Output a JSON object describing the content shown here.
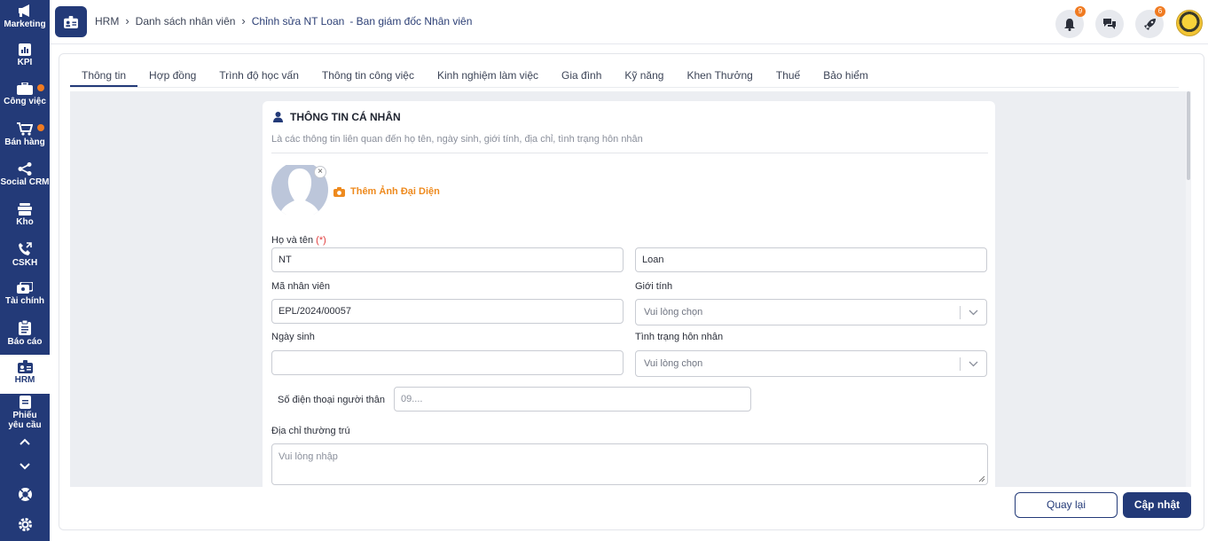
{
  "sidebar": {
    "items": [
      {
        "label": "Marketing",
        "icon": "megaphone-icon"
      },
      {
        "label": "KPI",
        "icon": "chart-icon"
      },
      {
        "label": "Công việc",
        "icon": "briefcase-icon",
        "dot": true
      },
      {
        "label": "Bán hàng",
        "icon": "cart-icon",
        "dot": true
      },
      {
        "label": "Social CRM",
        "icon": "share-icon"
      },
      {
        "label": "Kho",
        "icon": "warehouse-icon"
      },
      {
        "label": "CSKH",
        "icon": "phone-icon"
      },
      {
        "label": "Tài chính",
        "icon": "money-icon"
      },
      {
        "label": "Báo cáo",
        "icon": "clipboard-icon"
      },
      {
        "label": "HRM",
        "icon": "id-card-icon",
        "active": true
      },
      {
        "label": "Phiếu yêu cầu",
        "icon": "document-icon"
      }
    ]
  },
  "header": {
    "breadcrumb": {
      "root": "HRM",
      "list": "Danh sách nhân viên",
      "current": "Chỉnh sửa NT Loan",
      "dept": "- Ban giám đốc Nhân viên"
    },
    "notifications_count": "9",
    "rocket_count": "6"
  },
  "tabs": [
    "Thông tin",
    "Hợp đồng",
    "Trình độ học vấn",
    "Thông tin công việc",
    "Kinh nghiệm làm việc",
    "Gia đình",
    "Kỹ năng",
    "Khen Thưởng",
    "Thuế",
    "Bảo hiểm"
  ],
  "section": {
    "title": "THÔNG TIN CÁ NHÂN",
    "subtitle": "Là các thông tin liên quan đến họ tên, ngày sinh, giới tính, địa chỉ, tình trạng hôn nhân",
    "add_photo": "Thêm Ảnh Đại Diện"
  },
  "form": {
    "fullname_label": "Họ và tên",
    "required_mark": "(*)",
    "first_name": "NT",
    "last_name": "Loan",
    "employee_code_label": "Mã nhân viên",
    "employee_code": "EPL/2024/00057",
    "gender_label": "Giới tính",
    "gender_placeholder": "Vui lòng chọn",
    "dob_label": "Ngày sinh",
    "dob_value": "",
    "marital_label": "Tình trạng hôn nhân",
    "marital_placeholder": "Vui lòng chọn",
    "relative_phone_label": "Số điện thoại người thân",
    "relative_phone_placeholder": "09....",
    "address_label": "Địa chỉ thường trú",
    "address_placeholder": "Vui lòng nhập"
  },
  "footer": {
    "back_label": "Quay lại",
    "update_label": "Cập nhật"
  },
  "colors": {
    "primary": "#233a78",
    "accent": "#f07b22",
    "photo_link": "#ee8a1e"
  }
}
